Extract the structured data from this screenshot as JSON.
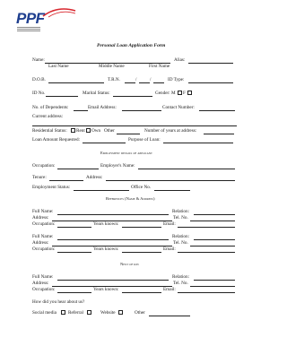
{
  "logo": {
    "text": "PPF"
  },
  "form": {
    "title": "Personal Loan Application Form",
    "name_label": "Name:",
    "alias_label": "Alias:",
    "last_name": "Last Name",
    "middle_name": "Middle Name",
    "first_name": "First Name",
    "dob_label": "D.O.B.",
    "trn_label": "T.R.N.",
    "id_type_label": "ID Type:",
    "id_no_label": "ID No.",
    "marital_label": "Marital Status:",
    "gender_label": "Gender: M",
    "gender_f": "F",
    "dependents_label": "No. of Dependents:",
    "email_label": "Email Address:",
    "contact_label": "Contact Number:",
    "current_address_label": "Current address:",
    "residential_label": "Residential Status:",
    "rent_label": "Rent",
    "own_label": "Own",
    "other_label": "Other",
    "years_at_address_label": "Number of years at address:",
    "loan_amount_label": "Loan Amount Requested:",
    "purpose_label": "Purpose of Loan:"
  },
  "employment": {
    "heading": "Employment details of applicant",
    "occupation_label": "Occupation:",
    "employer_label": "Employer's Name:",
    "tenure_label": "Tenure:",
    "address_label": "Address:",
    "status_label": "Employment Status:",
    "office_label": "Office No."
  },
  "references": {
    "heading": "References (Name & Address)",
    "full_name_label": "Full Name:",
    "relation_label": "Relation:",
    "address_label": "Address:",
    "tel_label": "Tel. No.",
    "occupation_label": "Occupation:",
    "years_known_label": "Years known:",
    "email_label": "Email:"
  },
  "next_of_kin": {
    "heading": "Next of kin",
    "full_name_label": "Full Name:",
    "relation_label": "Relation:",
    "address_label": "Address:",
    "tel_label": "Tel. No.",
    "occupation_label": "Occupation:",
    "years_known_label": "Years known:",
    "email_label": "Email:"
  },
  "hear_about": {
    "question": "How did you hear about us?",
    "social_media": "Social media",
    "referral": "Referral",
    "website": "Website",
    "other": "Other"
  }
}
